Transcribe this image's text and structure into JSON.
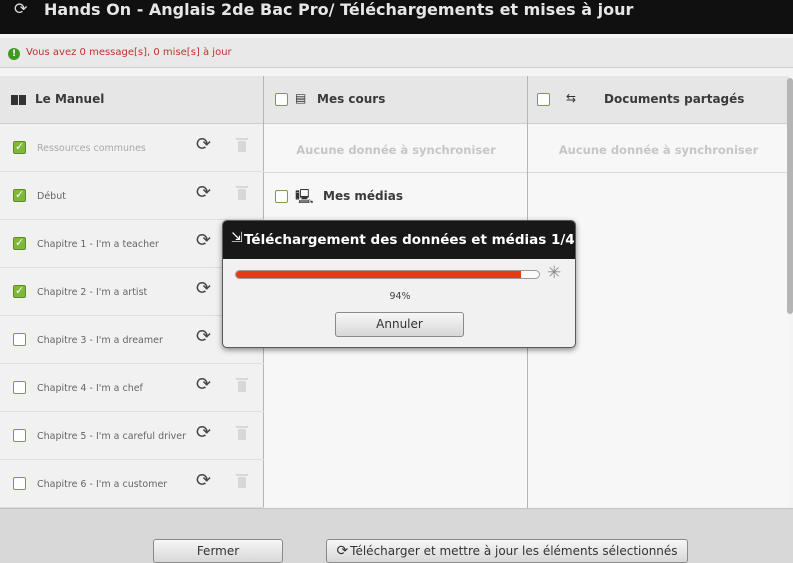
{
  "window": {
    "title": "Hands On - Anglais 2de Bac Pro/ Téléchargements et mises à jour"
  },
  "notification": {
    "message": "Vous avez 0 message[s], 0 mise[s] à jour",
    "color": "#c0322b"
  },
  "columns": {
    "manuel": {
      "title": "Le Manuel",
      "items": [
        {
          "label": "Ressources communes",
          "checked": true
        },
        {
          "label": "Début",
          "checked": true
        },
        {
          "label": "Chapitre 1  - I'm a teacher",
          "checked": true
        },
        {
          "label": "Chapitre 2 - I'm a artist",
          "checked": true
        },
        {
          "label": "Chapitre 3 - I'm a dreamer",
          "checked": false
        },
        {
          "label": "Chapitre  4 - I'm a chef",
          "checked": false
        },
        {
          "label": "Chapitre 5 - I'm a careful driver",
          "checked": false
        },
        {
          "label": "Chapitre 6 - I'm a customer",
          "checked": false
        }
      ]
    },
    "cours": {
      "title": "Mes cours",
      "empty": "Aucune donnée à synchroniser",
      "media_title": "Mes médias"
    },
    "docs": {
      "title": "Documents partagés",
      "empty": "Aucune donnée à synchroniser"
    }
  },
  "footer": {
    "close_label": "Fermer",
    "download_label": "Télécharger et mettre à jour les éléments sélectionnés"
  },
  "modal": {
    "title": "Téléchargement des données et médias 1/4",
    "progress": 0.94,
    "percent_text": "94%",
    "cancel_label": "Annuler",
    "progress_color": "#e8381a"
  }
}
